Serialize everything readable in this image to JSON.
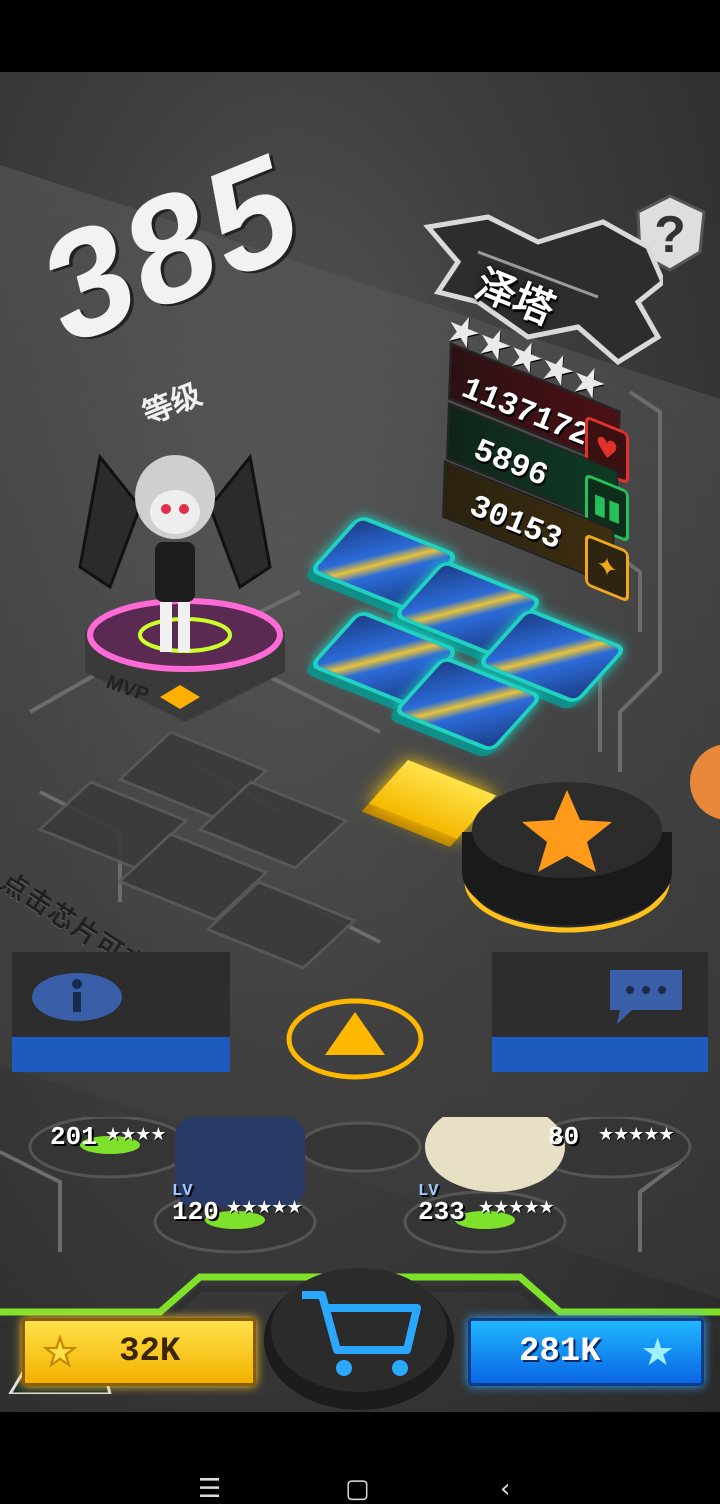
{
  "hero": {
    "level": "385",
    "level_label": "等级",
    "name": "泽塔",
    "stars": "★★★★★",
    "stats": [
      {
        "value": "1137172",
        "icon": "heart-icon",
        "color": "#e0312b"
      },
      {
        "value": "5896",
        "icon": "shield-icon",
        "color": "#25c05a"
      },
      {
        "value": "30153",
        "icon": "star-icon",
        "color": "#f1a91a"
      }
    ],
    "platform_label": "MVP"
  },
  "hint": "点击芯片可查看详情",
  "team": [
    {
      "lv": "201",
      "stars": "★★★★"
    },
    {
      "lv_label": "LV",
      "lv": "120",
      "stars": "★★★★★"
    },
    {
      "lv_label": "LV",
      "lv": "233",
      "stars": "★★★★★"
    },
    {
      "lv": "80",
      "stars": "★★★★★"
    }
  ],
  "currency": {
    "gold": "32K",
    "crystal": "281K"
  },
  "colors": {
    "gold": "#ffd21f",
    "blue": "#1a8cff",
    "teal": "#1fd2c2",
    "orange": "#ff9a1a"
  }
}
